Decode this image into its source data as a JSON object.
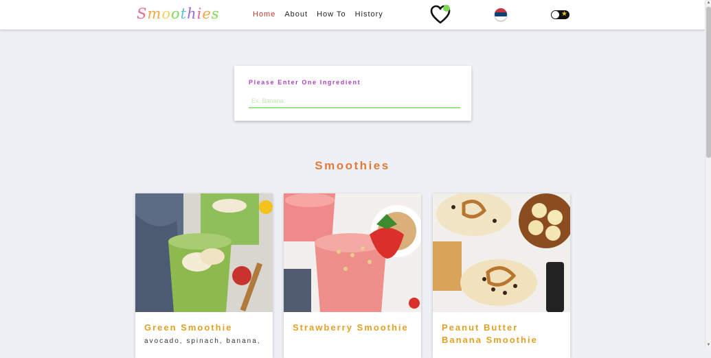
{
  "header": {
    "logo_text": "Smoothies",
    "nav": [
      "Home",
      "About",
      "How To",
      "History"
    ],
    "active_nav": "Home",
    "favorites_icon": "heart-icon",
    "language_flag": "serbia-flag-icon",
    "theme_toggle": "dark-mode-toggle"
  },
  "search": {
    "label": "Please Enter One Ingredient",
    "placeholder": "Ex. Banana"
  },
  "section": {
    "title": "Smoothies"
  },
  "cards": [
    {
      "title": "Green Smoothie",
      "desc": "avocado, spinach, banana,"
    },
    {
      "title": "Strawberry Smoothie",
      "desc": ""
    },
    {
      "title": "Peanut Butter Banana Smoothie",
      "desc": ""
    }
  ],
  "colors": {
    "accent_title": "#e07b39",
    "card_title": "#e5a024",
    "search_label": "#b03fc4",
    "active_nav": "#c0392b",
    "heart_badge": "#7ed957"
  }
}
